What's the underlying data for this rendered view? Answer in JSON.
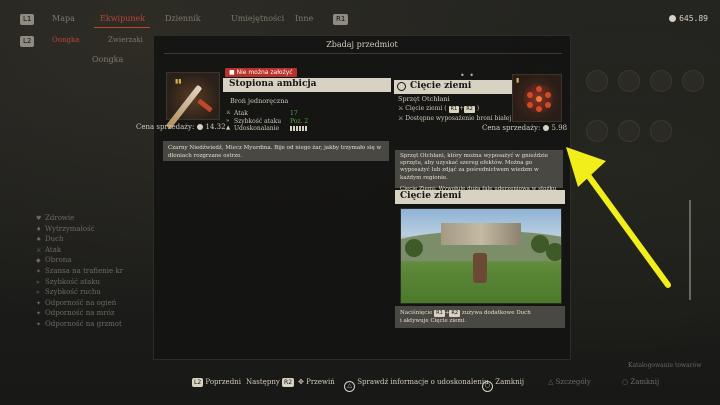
{
  "top_bar": {
    "shoulder_left": "L1",
    "shoulder_right": "R1",
    "tabs": [
      "Mapa",
      "Ekwipunek",
      "Dziennik",
      "Umiejętności",
      "Inne"
    ],
    "active_tab": "Ekwipunek",
    "currency": "645.89"
  },
  "sub_bar": {
    "shoulder_left": "L2",
    "tabs": [
      "Oongka",
      "Zwierzaki"
    ],
    "character": "Oongka"
  },
  "background_stats": [
    "Zdrowie",
    "Wytrzymałość",
    "Duch",
    "Atak",
    "Obrona",
    "Szansa na trafienie kr",
    "Szybkość ataku",
    "Szybkość ruchu",
    "Odporność na ogień",
    "Odporność na mróz",
    "Odporność na grzmot"
  ],
  "panel": {
    "title": "Zbadaj przedmiot",
    "dots": "• •"
  },
  "item_left": {
    "warning": "Nie można założyć",
    "name": "Stopiona ambicja",
    "type": "Broń jednoręczna",
    "stats": [
      {
        "label": "Atak",
        "value": "17"
      },
      {
        "label": "Szybkość ataku",
        "value": "Poz. 2"
      },
      {
        "label": "Udoskonalanie",
        "value": ""
      }
    ],
    "price_label": "Cena sprzedaży:",
    "price": "14.32",
    "description": "Czarny Niedźwiedź, Miecz Myurdina. Bije od niego żar, jakby trzymało się w dłoniach rozgrzane ostrze."
  },
  "item_right": {
    "name": "Cięcie ziemi",
    "type": "Sprzęt Otchłani",
    "line1": "Cięcie ziemi",
    "line1_keys": [
      "R1",
      "R2"
    ],
    "line2": "Dostępne wyposażenie broni białej",
    "price_label": "Cena sprzedaży:",
    "price": "5.98",
    "description_1": "Sprzęt Otchłani, który można wyposażyć w gnieździe sprzętu, aby uzyskać szereg efektów. Można go wyposażyć lub zdjąć za pośrednictwem wiedzm w każdym regionie.",
    "description_2": "Cięcie Ziemi: Wywołuje dużą falę uderzeniową w stożku przed sobą."
  },
  "ability": {
    "title": "Cięcie ziemi",
    "instruction_pre": "Naciśnięcie",
    "instruction_keys": [
      "R1",
      "R2"
    ],
    "instruction_post": "zużywa dodatkowe Duch",
    "instruction_line2": "i aktywuje Cięcie ziemi."
  },
  "bottom_prompts": {
    "prev_key": "L2",
    "prev": "Poprzedni",
    "next": "Następny",
    "next_key": "R2",
    "scroll": "Przewiń",
    "check": "Sprawdź informacje o udoskonaleniu",
    "close": "Zamknij",
    "bg_details": "Szczegóły",
    "bg_close": "Zamknij",
    "bg_catalog": "Katalogowanie towarów"
  },
  "colors": {
    "accent_red": "#b8443a",
    "stat_green": "#5aa34a",
    "highlight_arrow": "#f2ee1c"
  }
}
